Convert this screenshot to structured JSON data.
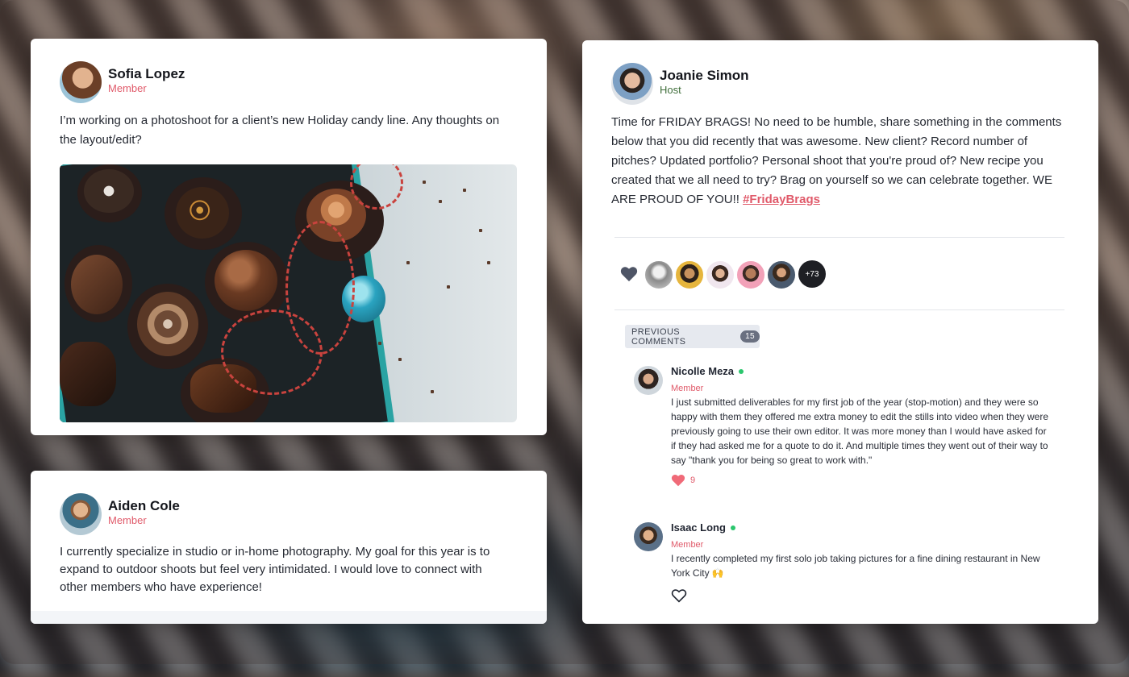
{
  "colors": {
    "accent": "#e05a6a",
    "host_green": "#3f6e3a",
    "online": "#2bc66d",
    "teal_tin": "#2aa3a3"
  },
  "post1": {
    "author": "Sofia Lopez",
    "role": "Member",
    "text": "I’m working on a photoshoot for a client’s new Holiday candy line. Any thoughts on the layout/edit?",
    "image": "chocolates-in-teal-tin-photo"
  },
  "post2": {
    "author": "Aiden Cole",
    "role": "Member",
    "text": "I currently specialize in studio or in-home photography. My goal for this year is to expand to outdoor shoots but feel very intimidated. I would love to connect with other members who have experience!"
  },
  "post3": {
    "author": "Joanie Simon",
    "role": "Host",
    "text": "Time for FRIDAY BRAGS! No need to be humble, share something in the comments below that you did recently that was awesome.  New client? Record number of pitches?  Updated portfolio? Personal shoot that you're proud of? New recipe you created that we all need to try? Brag on yourself so we can celebrate together.  WE ARE PROUD OF YOU!! ",
    "hashtag": "#FridayBrags",
    "reactions_more": "+73",
    "previous_comments_label": "PREVIOUS COMMENTS",
    "previous_comments_count": "15",
    "comments": [
      {
        "author": "Nicolle Meza",
        "role": "Member",
        "text": "I just submitted deliverables for my first job of the year (stop-motion) and they were so happy with them they offered me extra money to edit the stills into video when they were previously going to use their own editor. It was more money than I would have asked for if they had asked me for a quote to do it. And multiple times they went out of their way to say \"thank you for being so great to work with.\"",
        "likes": "9"
      },
      {
        "author": "Isaac Long",
        "role": "Member",
        "text": "I recently completed my first solo job taking pictures for a fine dining restaurant in New York City 🙌"
      }
    ]
  }
}
